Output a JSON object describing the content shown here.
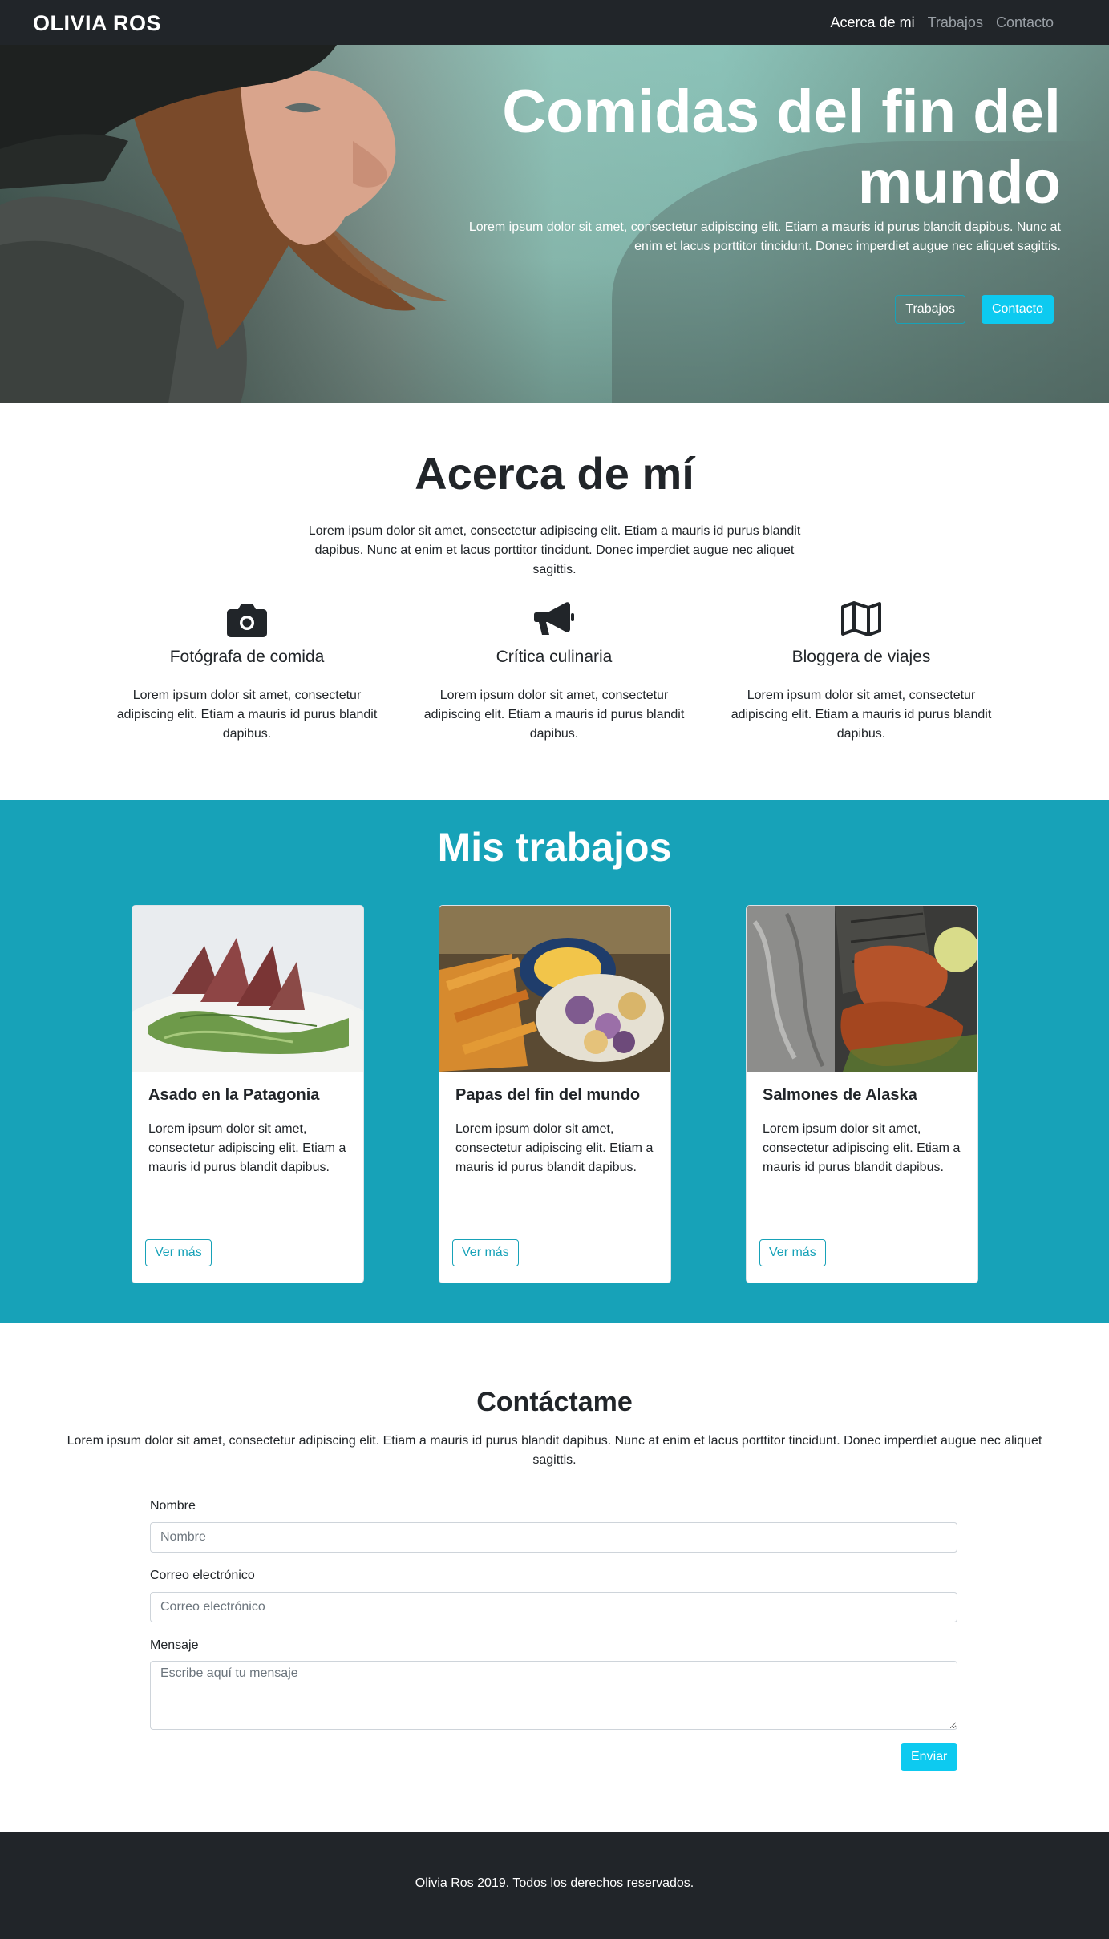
{
  "navbar": {
    "brand": "OLIVIA ROS",
    "links": [
      "Acerca de mi",
      "Trabajos",
      "Contacto"
    ]
  },
  "hero": {
    "title": "Comidas del fin del mundo",
    "text": "Lorem ipsum dolor sit amet, consectetur adipiscing elit. Etiam a mauris id purus blandit dapibus. Nunc at enim et lacus porttitor tincidunt. Donec imperdiet augue nec aliquet sagittis.",
    "button_works": "Trabajos",
    "button_contact": "Contacto"
  },
  "about": {
    "title": "Acerca de mí",
    "text": "Lorem ipsum dolor sit amet, consectetur adipiscing elit. Etiam a mauris id purus blandit dapibus. Nunc at enim et lacus porttitor tincidunt. Donec imperdiet augue nec aliquet sagittis.",
    "features": [
      {
        "icon": "camera-icon",
        "title": "Fotógrafa de comida",
        "text": "Lorem ipsum dolor sit amet, consectetur adipiscing elit. Etiam a mauris id purus blandit dapibus."
      },
      {
        "icon": "megaphone-icon",
        "title": "Crítica culinaria",
        "text": "Lorem ipsum dolor sit amet, consectetur adipiscing elit. Etiam a mauris id purus blandit dapibus."
      },
      {
        "icon": "map-icon",
        "title": "Bloggera de viajes",
        "text": "Lorem ipsum dolor sit amet, consectetur adipiscing elit. Etiam a mauris id purus blandit dapibus."
      }
    ]
  },
  "works": {
    "title": "Mis trabajos",
    "cards": [
      {
        "title": "Asado en la Patagonia",
        "text": "Lorem ipsum dolor sit amet, consectetur adipiscing elit. Etiam a mauris id purus blandit dapibus.",
        "button": "Ver más"
      },
      {
        "title": "Papas del fin del mundo",
        "text": "Lorem ipsum dolor sit amet, consectetur adipiscing elit. Etiam a mauris id purus blandit dapibus.",
        "button": "Ver más"
      },
      {
        "title": "Salmones de Alaska",
        "text": "Lorem ipsum dolor sit amet, consectetur adipiscing elit. Etiam a mauris id purus blandit dapibus.",
        "button": "Ver más"
      }
    ]
  },
  "contact": {
    "title": "Contáctame",
    "text": "Lorem ipsum dolor sit amet, consectetur adipiscing elit. Etiam a mauris id purus blandit dapibus. Nunc at enim et lacus porttitor tincidunt. Donec imperdiet augue nec aliquet sagittis.",
    "name_label": "Nombre",
    "name_placeholder": "Nombre",
    "email_label": "Correo electrónico",
    "email_placeholder": "Correo electrónico",
    "message_label": "Mensaje",
    "message_placeholder": "Escribe aquí tu mensaje",
    "submit": "Enviar"
  },
  "footer": {
    "text": "Olivia Ros 2019. Todos los derechos reservados."
  },
  "colors": {
    "dark": "#212529",
    "accent": "#17a2b8",
    "button_info": "#0dcaf0"
  }
}
